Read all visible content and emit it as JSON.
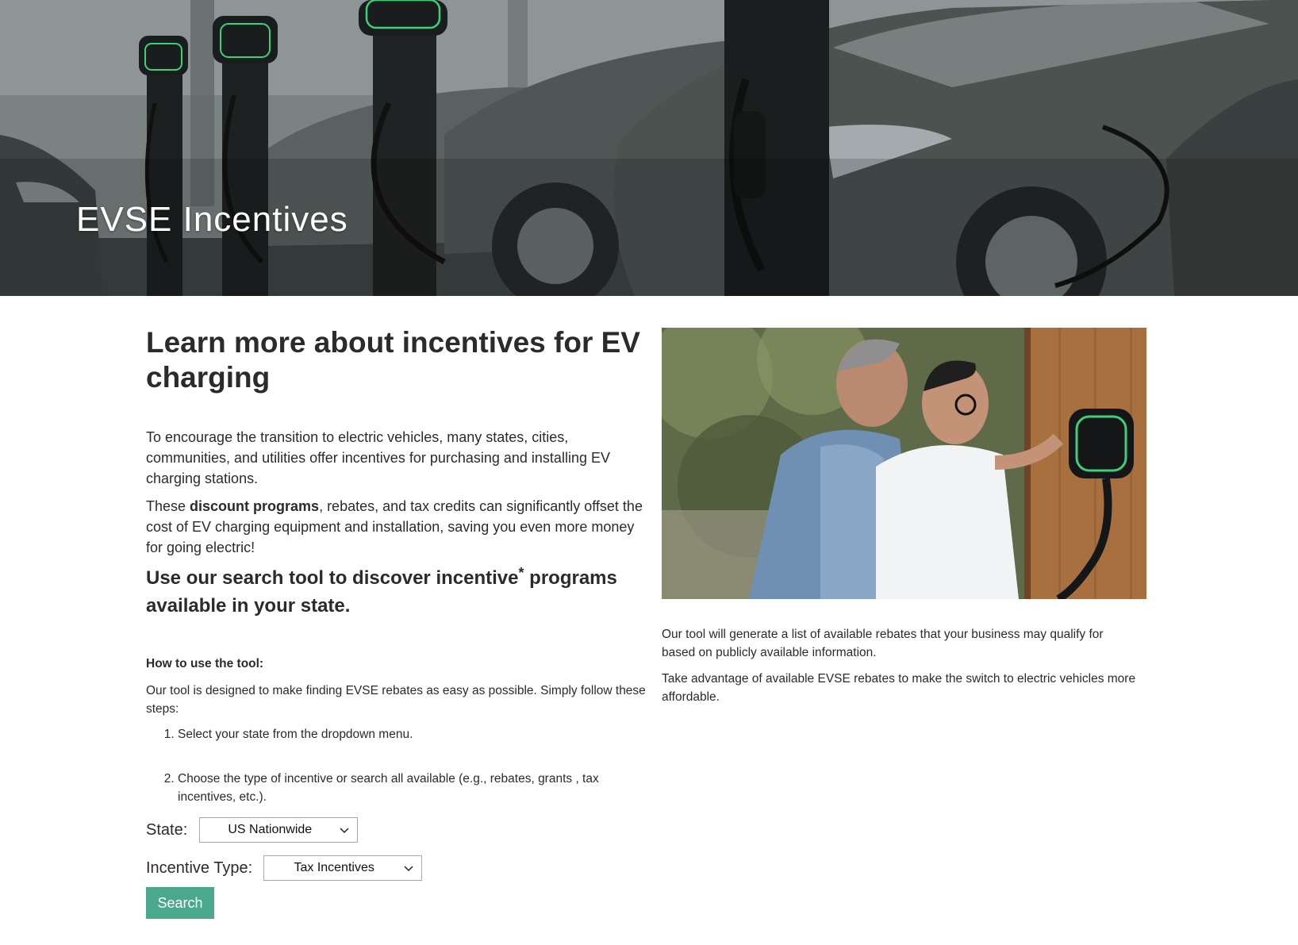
{
  "hero": {
    "title": "EVSE Incentives"
  },
  "intro": {
    "heading": "Learn more about incentives for EV charging",
    "paragraph1": "To encourage the transition to electric vehicles, many states, cities, communities, and utilities offer incentives for purchasing and installing EV charging stations.",
    "paragraph2_prefix": "These ",
    "paragraph2_bold": "discount programs",
    "paragraph2_suffix": ", rebates, and tax credits can significantly offset the cost of EV charging equipment and installation, saving you even more money for going electric!",
    "search_heading_part1": "Use our search tool to discover incentive",
    "search_heading_sup": "*",
    "search_heading_part2": " programs available in your state."
  },
  "howto": {
    "label": "How to use the tool:",
    "description": "Our tool is designed to make finding EVSE rebates as easy as possible. Simply follow these steps:",
    "steps": [
      "Select your state from the dropdown menu.",
      "Choose the type of incentive or search all available (e.g., rebates, grants , tax incentives, etc.)."
    ]
  },
  "form": {
    "state_label": "State:",
    "state_value": "US Nationwide",
    "type_label": "Incentive Type:",
    "type_value": "Tax Incentives",
    "search_button": "Search"
  },
  "right": {
    "paragraph1": "Our tool will generate a list of available rebates that your business may qualify for based on publicly available information.",
    "paragraph2": "Take advantage of available EVSE rebates to make the switch to electric vehicles more affordable."
  },
  "icons": {
    "dropdown": "chevron-down-icon"
  },
  "colors": {
    "button_bg": "#4aa98d",
    "charger_ring": "#3fcf7a"
  }
}
